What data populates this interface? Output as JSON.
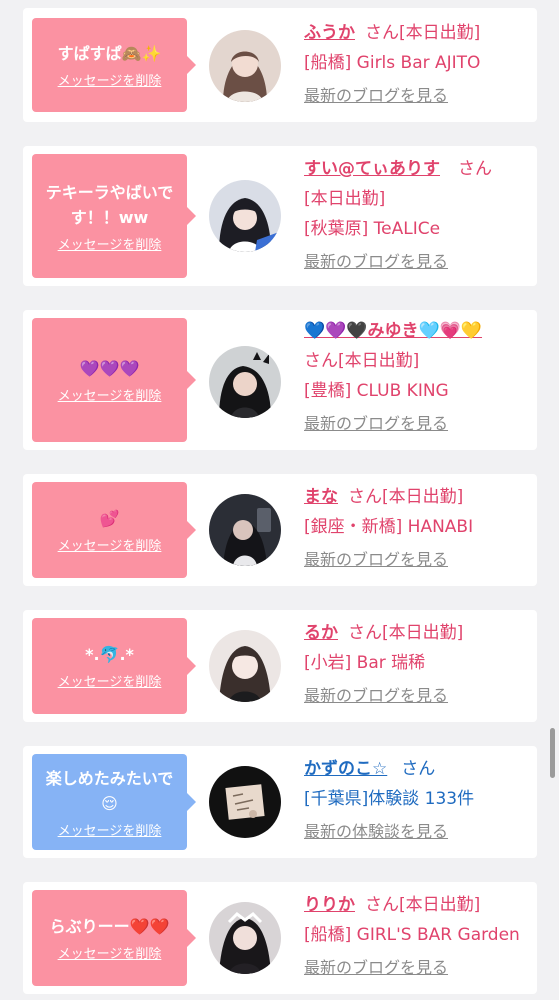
{
  "cards": [
    {
      "theme": "pink",
      "message": "すぱすぱ🙈✨",
      "delete_label": "メッセージを削除",
      "name": "ふうか",
      "name_suffix": "さん",
      "status": "[本日出勤]",
      "lines": [
        "[船橋] Girls Bar AJITO"
      ],
      "link": "最新のブログを見る",
      "avatar_icon": "avatar-girl-photo"
    },
    {
      "theme": "pink",
      "message": "テキーラやばいです！！ww",
      "delete_label": "メッセージを削除",
      "name": "すい@てぃありす",
      "name_suffix": "さん",
      "status": "[本日出勤]",
      "lines": [
        "[秋葉原] TeALICe"
      ],
      "link": "最新のブログを見る",
      "avatar_icon": "avatar-girl-photo"
    },
    {
      "theme": "pink",
      "message": "💜💜💜",
      "delete_label": "メッセージを削除",
      "name": "💙💜🖤みゆき🩵💗💛",
      "name_suffix": "さん",
      "status": "[本日出勤]",
      "lines": [
        "[豊橋] CLUB KING"
      ],
      "link": "最新のブログを見る",
      "avatar_icon": "avatar-girl-photo"
    },
    {
      "theme": "pink",
      "message": "💕",
      "delete_label": "メッセージを削除",
      "name": "まな",
      "name_suffix": "さん",
      "status": "[本日出勤]",
      "lines": [
        "[銀座・新橋] HANABI"
      ],
      "link": "最新のブログを見る",
      "avatar_icon": "avatar-girl-photo"
    },
    {
      "theme": "pink",
      "message": "*.🐬.*",
      "delete_label": "メッセージを削除",
      "name": "るか",
      "name_suffix": "さん",
      "status": "[本日出勤]",
      "lines": [
        "[小岩] Bar 瑞稀"
      ],
      "link": "最新のブログを見る",
      "avatar_icon": "avatar-girl-photo"
    },
    {
      "theme": "blue",
      "message": "楽しめたみたいで😌",
      "delete_label": "メッセージを削除",
      "name": "かずのこ☆",
      "name_suffix": "さん",
      "status": "",
      "lines": [
        "[千葉県]体験談 133件"
      ],
      "link": "最新の体験談を見る",
      "avatar_icon": "avatar-sketch-photo"
    },
    {
      "theme": "pink",
      "message": "らぶりーー❤️❤️",
      "delete_label": "メッセージを削除",
      "name": "りりか",
      "name_suffix": "さん",
      "status": "[本日出勤]",
      "lines": [
        "[船橋] GIRL'S BAR Garden"
      ],
      "link": "最新のブログを見る",
      "avatar_icon": "avatar-girl-photo"
    }
  ],
  "colors": {
    "pink_bubble": "#fb92a2",
    "blue_bubble": "#86b3f5",
    "pink_text": "#e0436c",
    "blue_text": "#1f6bc0",
    "link_gray": "#8b8b8b"
  }
}
